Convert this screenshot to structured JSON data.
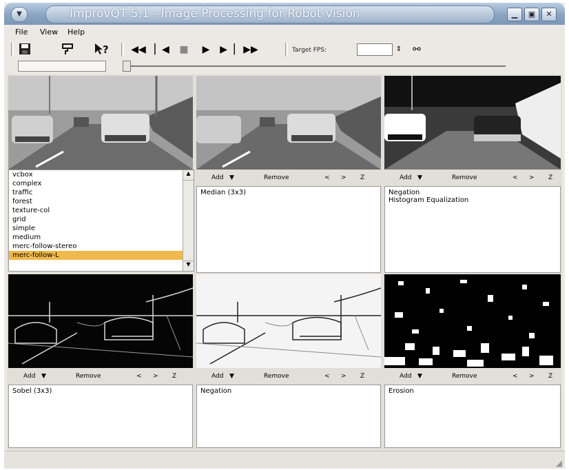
{
  "window": {
    "title": "ImprovQT 5.1 - Image Processing for Robot Vision",
    "menu_icon": "menu-icon",
    "buttons": [
      "minimize-icon",
      "maximize-icon",
      "close-icon"
    ]
  },
  "menubar": {
    "file": "File",
    "view": "View",
    "help": "Help"
  },
  "toolbar": {
    "fps_label": "Target FPS:",
    "fps_value": "",
    "icons": [
      "save-icon",
      "paint-roller-icon",
      "whats-this-icon",
      "rewind-icon",
      "step-back-icon",
      "stop-icon",
      "play-icon",
      "step-forward-icon",
      "fast-forward-icon",
      "link-icon"
    ]
  },
  "sequence_list": {
    "items": [
      "vcbox",
      "complex",
      "traffic",
      "forest",
      "texture-col",
      "grid",
      "simple",
      "medium",
      "merc-follow-stereo",
      "merc-follow-L"
    ],
    "selected": "merc-follow-L"
  },
  "controls": {
    "add": "Add",
    "remove": "Remove",
    "prev": "<",
    "next": ">",
    "z": "Z"
  },
  "panels": [
    {
      "ops": [
        "Median (3x3)"
      ]
    },
    {
      "ops": [
        "Negation",
        "Histogram Equalization"
      ]
    },
    {
      "ops": [
        "Sobel (3x3)"
      ]
    },
    {
      "ops": [
        "Negation"
      ]
    },
    {
      "ops": [
        "Erosion"
      ]
    }
  ],
  "colors": {
    "title_bar": "#8aa4c2",
    "selection": "#f0b94c",
    "window_bg": "#ece9e4"
  }
}
